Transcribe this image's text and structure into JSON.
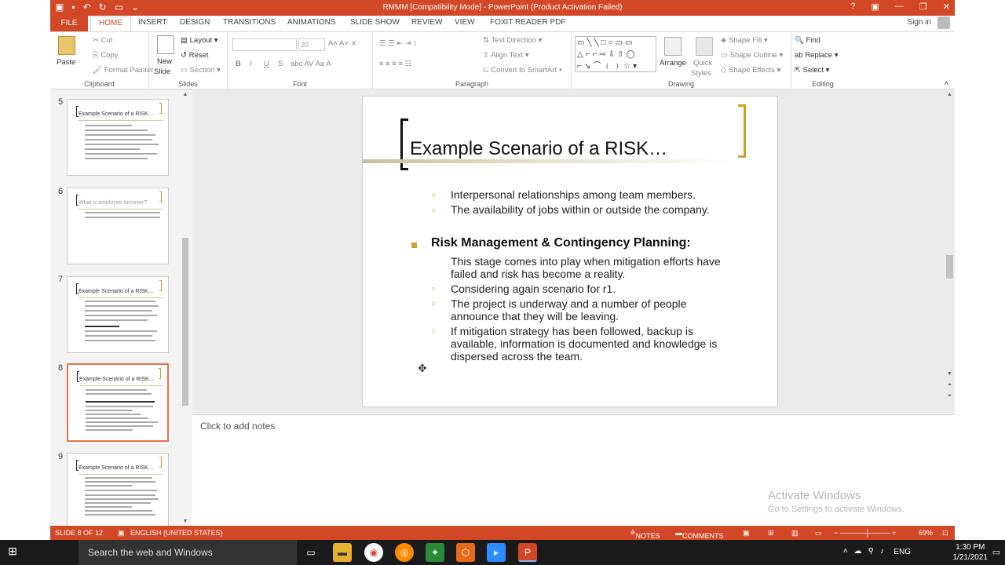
{
  "window": {
    "title": "RMMM [Compatibility Mode] - PowerPoint (Product Activation Failed)",
    "help_icon": "?",
    "minimize_icon": "—",
    "restore_icon": "❐",
    "close_icon": "✕"
  },
  "tabs": [
    "FILE",
    "HOME",
    "INSERT",
    "DESIGN",
    "TRANSITIONS",
    "ANIMATIONS",
    "SLIDE SHOW",
    "REVIEW",
    "VIEW",
    "FOXIT READER PDF"
  ],
  "signin": "Sign in",
  "ribbon": {
    "clipboard": {
      "paste": "Paste",
      "cut": "Cut",
      "copy": "Copy",
      "format_painter": "Format Painter",
      "label": "Clipboard"
    },
    "slides": {
      "new_slide": "New",
      "new_slide2": "Slide",
      "layout": "Layout",
      "reset": "Reset",
      "section": "Section",
      "label": "Slides"
    },
    "font": {
      "size": "20",
      "bold": "B",
      "italic": "I",
      "underline": "U",
      "strike": "S",
      "label": "Font"
    },
    "paragraph": {
      "text_direction": "Text Direction",
      "align_text": "Align Text",
      "convert": "Convert to SmartArt",
      "label": "Paragraph"
    },
    "drawing": {
      "arrange": "Arrange",
      "quick": "Quick",
      "styles": "Styles",
      "shape_fill": "Shape Fill",
      "shape_outline": "Shape Outline",
      "shape_effects": "Shape Effects",
      "label": "Drawing"
    },
    "editing": {
      "find": "Find",
      "replace": "Replace",
      "select": "Select",
      "label": "Editing"
    }
  },
  "thumbnails": [
    {
      "num": "5",
      "title": "Example Scenario of a RISK…"
    },
    {
      "num": "6",
      "title": "What is employee turnover?"
    },
    {
      "num": "7",
      "title": "Example Scenario of a RISK…"
    },
    {
      "num": "8",
      "title": "Example Scenario of a RISK…"
    },
    {
      "num": "9",
      "title": "Example Scenario of a RISK…"
    }
  ],
  "slide": {
    "title": "Example Scenario of a RISK…",
    "b1": "Interpersonal relationships among team members.",
    "b2": "The availability of jobs within or outside the company.",
    "heading": "Risk Management & Contingency Planning:",
    "p1": "This stage comes into play when mitigation efforts have failed and risk has become a reality.",
    "b3": "Considering again scenario for r1.",
    "b4": "The project is underway and a number of people announce that they will be leaving.",
    "b5": "If mitigation strategy has been followed, backup is available, information is documented and knowledge is dispersed across the team."
  },
  "notes_placeholder": "Click to add notes",
  "activate": {
    "line1": "Activate Windows",
    "line2": "Go to Settings to activate Windows."
  },
  "status": {
    "slide": "SLIDE 8 OF 12",
    "lang": "ENGLISH (UNITED STATES)",
    "notes": "NOTES",
    "comments": "COMMENTS",
    "zoom": "69%"
  },
  "taskbar": {
    "search": "Search the web and Windows",
    "lang": "ENG",
    "time": "1:30 PM",
    "date": "1/21/2021"
  }
}
